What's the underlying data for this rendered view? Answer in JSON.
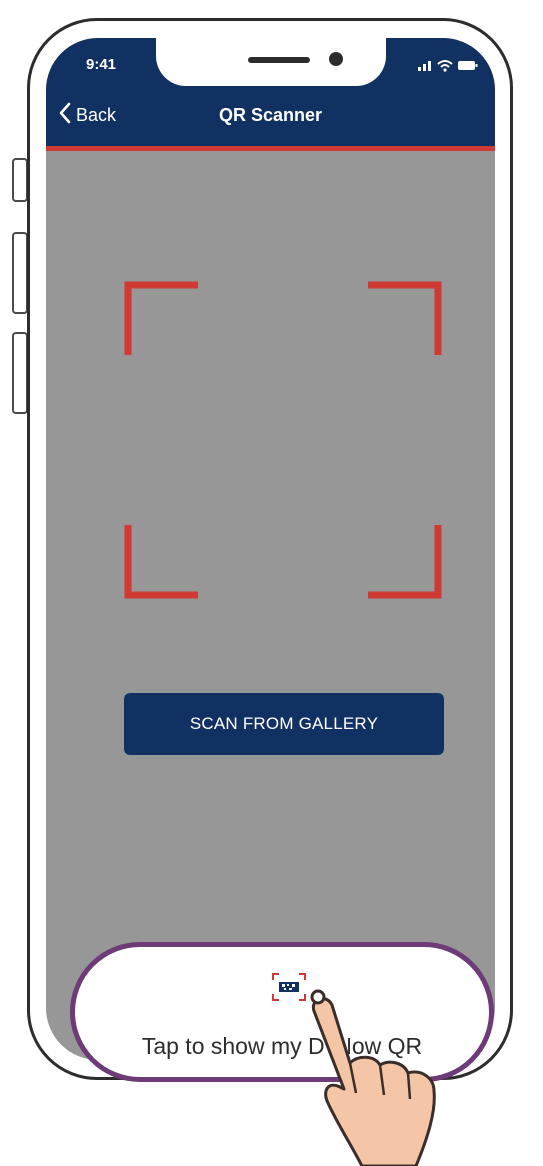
{
  "status_bar": {
    "time": "9:41"
  },
  "nav": {
    "back_label": "Back",
    "title": "QR Scanner"
  },
  "scanner": {
    "gallery_button_label": "SCAN FROM GALLERY"
  },
  "bottom_sheet": {
    "label": "Tap to show my D’ Now QR"
  },
  "icons": {
    "back": "chevron-left-icon",
    "signal": "signal-icon",
    "wifi": "wifi-icon",
    "battery": "battery-icon",
    "qr": "qr-code-icon",
    "hand": "tap-hand-icon"
  },
  "colors": {
    "navy": "#123163",
    "accent_red": "#cf3a35",
    "camera_gray": "#979797",
    "pill_border": "#6c3b78",
    "skin": "#f4c6a7"
  }
}
